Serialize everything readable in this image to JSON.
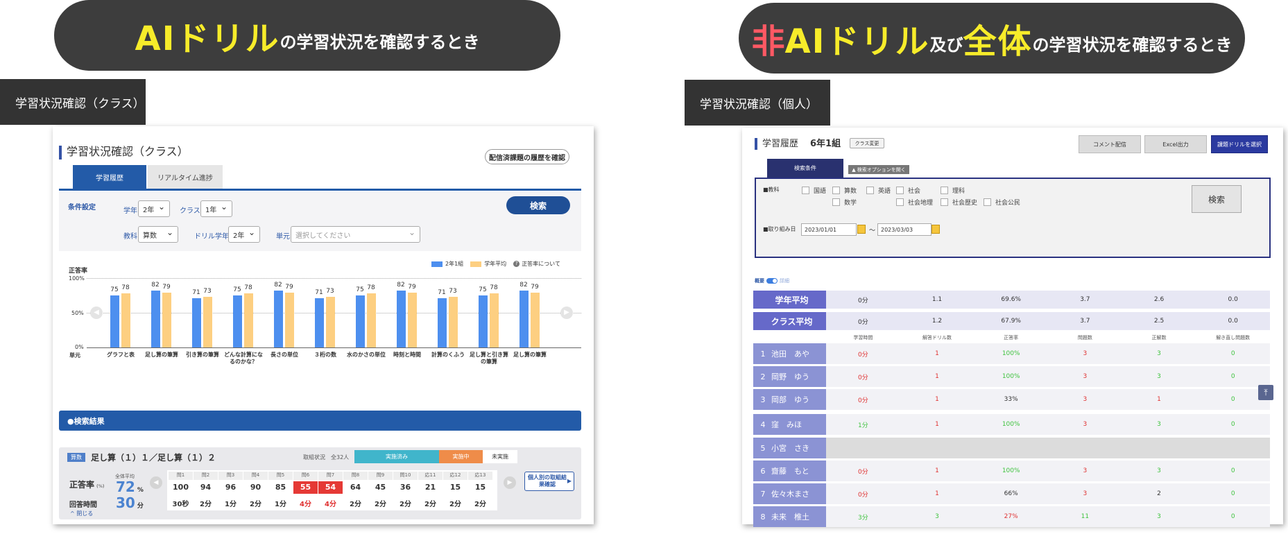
{
  "header_left": {
    "big": "AIドリル",
    "small": "の学習状況を確認するとき"
  },
  "header_right": {
    "red": "非",
    "big1": "AIドリル",
    "small1": "及び",
    "big2": "全体",
    "small2": "の学習状況を確認するとき"
  },
  "tab_left": "学習状況確認（クラス）",
  "tab_right": "学習状況確認（個人）",
  "left": {
    "title": "学習状況確認（クラス）",
    "history_button": "配信済課題の履歴を確認",
    "tabs": [
      "学習履歴",
      "リアルタイム進捗"
    ],
    "conditions_label": "条件設定",
    "grade_label": "学年",
    "grade_value": "2年",
    "class_label": "クラス",
    "class_value": "1年",
    "subject_label": "教科",
    "subject_value": "算数",
    "drill_grade_label": "ドリル学年",
    "drill_grade_value": "2年",
    "unit_label": "単元",
    "unit_placeholder": "選択してください",
    "search_button": "検索",
    "legend": [
      "2年1組",
      "学年平均",
      "正答率について"
    ],
    "y_title": "正答率",
    "x_title": "単元",
    "results_header": "●検索結果",
    "subject_tag": "算数",
    "result_title": "足し算（１）１／足し算（１）２",
    "status_label": "取組状況　全32人",
    "status": [
      "実施済み",
      "実施中",
      "未実施"
    ],
    "rate_label": "正答率",
    "rate_unit_small": "(%)",
    "avg_label": "全体平均",
    "avg_rate": "72",
    "avg_rate_unit": "%",
    "time_label": "回答時間",
    "avg_time": "30",
    "avg_time_unit": "分",
    "close_label": "閉じる",
    "q_headers": [
      "問1",
      "問2",
      "問3",
      "問4",
      "問5",
      "問6",
      "問7",
      "問8",
      "問9",
      "問10",
      "応11",
      "応12",
      "応13"
    ],
    "q_rates": [
      "100",
      "94",
      "96",
      "90",
      "85",
      "55",
      "54",
      "64",
      "45",
      "36",
      "21",
      "15",
      "15"
    ],
    "q_times": [
      "30秒",
      "2分",
      "1分",
      "2分",
      "1分",
      "4分",
      "4分",
      "2分",
      "2分",
      "2分",
      "2分",
      "2分",
      "2分"
    ],
    "detail_button": "個人別の取組結果確認"
  },
  "chart_data": {
    "type": "bar",
    "categories": [
      "グラフと表",
      "足し算の筆算",
      "引き算の筆算",
      "どんな計算になるのかな？",
      "長さの単位",
      "３桁の数",
      "水のかさの単位",
      "時刻と時間",
      "計算のくふう",
      "足し算と引き算の筆算",
      "足し算の筆算"
    ],
    "series": [
      {
        "name": "2年1組",
        "values": [
          75,
          82,
          71,
          75,
          82,
          71,
          75,
          82,
          71,
          75,
          82
        ]
      },
      {
        "name": "学年平均",
        "values": [
          78,
          79,
          73,
          78,
          79,
          73,
          78,
          79,
          73,
          78,
          79
        ]
      }
    ],
    "ylabel": "正答率",
    "xlabel": "単元",
    "ylim": [
      0,
      100
    ],
    "yticks": [
      "100%",
      "50%",
      "0%"
    ],
    "colors": {
      "2年1組": "#4d8fef",
      "学年平均": "#fdcf81"
    }
  },
  "right": {
    "title": "学習履歴",
    "class_name": "6年1組",
    "class_change": "クラス変更",
    "buttons": [
      "コメント配信",
      "Excel出力",
      "課題ドリルを選択"
    ],
    "search_tab": "検索条件",
    "option_tab": "▲ 検索オプションを開く",
    "subject_label": "■教科",
    "subjects": [
      "国語",
      "算数",
      "英語",
      "社会",
      "理科",
      "数学",
      "社会地理",
      "社会歴史",
      "社会公民"
    ],
    "date_label": "■取り組み日",
    "date_from": "2023/01/01",
    "date_to": "2023/03/03",
    "tilde": "～",
    "search_button": "検索",
    "toggle": [
      "概要",
      "詳細"
    ],
    "grade_avg": {
      "label": "学年平均",
      "values": [
        "0分",
        "1.1",
        "69.6%",
        "3.7",
        "2.6",
        "0.0"
      ]
    },
    "class_avg": {
      "label": "クラス平均",
      "values": [
        "0分",
        "1.2",
        "67.9%",
        "3.7",
        "2.5",
        "0.0"
      ]
    },
    "columns": [
      "学習時間",
      "解答ドリル数",
      "正答率",
      "問題数",
      "正解数",
      "解き直し問題数"
    ],
    "students": [
      {
        "n": "1",
        "name": "池田　あや",
        "v": [
          "0分",
          "1",
          "100%",
          "3",
          "3",
          "0"
        ]
      },
      {
        "n": "2",
        "name": "岡野　ゆう",
        "v": [
          "0分",
          "1",
          "100%",
          "3",
          "3",
          "0"
        ]
      },
      {
        "n": "3",
        "name": "岡部　ゆう",
        "v": [
          "0分",
          "1",
          "33%",
          "3",
          "1",
          "0"
        ]
      },
      {
        "n": "4",
        "name": "窪　みほ",
        "v": [
          "1分",
          "1",
          "100%",
          "3",
          "3",
          "0"
        ]
      },
      {
        "n": "5",
        "name": "小宮　さき",
        "v": [
          "",
          "",
          "",
          "",
          "",
          ""
        ]
      },
      {
        "n": "6",
        "name": "齋藤　もと",
        "v": [
          "0分",
          "1",
          "100%",
          "3",
          "3",
          "0"
        ]
      },
      {
        "n": "7",
        "name": "佐々木まさ",
        "v": [
          "0分",
          "1",
          "66%",
          "3",
          "2",
          "0"
        ]
      },
      {
        "n": "8",
        "name": "未来　椎土",
        "v": [
          "3分",
          "3",
          "27%",
          "11",
          "3",
          "0"
        ]
      }
    ]
  }
}
